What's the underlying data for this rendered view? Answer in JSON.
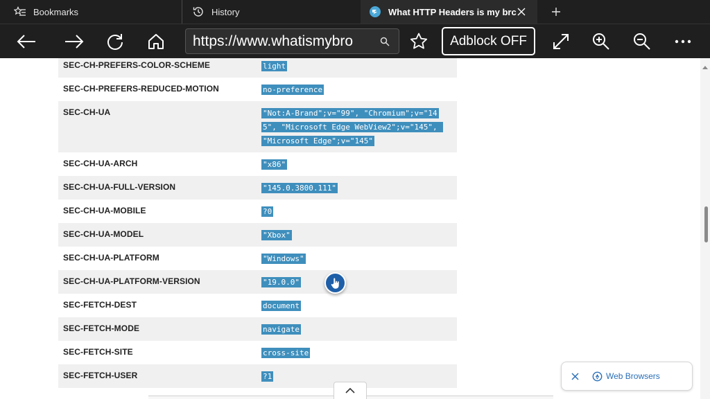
{
  "tabs": {
    "bookmarks": {
      "label": "Bookmarks",
      "icon": "bookmarks-icon"
    },
    "history": {
      "label": "History",
      "icon": "history-icon"
    },
    "active": {
      "label": "What HTTP Headers is my brc",
      "icon": "site-favicon"
    }
  },
  "toolbar": {
    "url": "https://www.whatismybro",
    "adblock_label": "Adblock OFF"
  },
  "headers": [
    {
      "name": "SEC-CH-PREFERS-COLOR-SCHEME",
      "value": "light"
    },
    {
      "name": "SEC-CH-PREFERS-REDUCED-MOTION",
      "value": "no-preference"
    },
    {
      "name": "SEC-CH-UA",
      "value": "\"Not:A-Brand\";v=\"99\", \"Chromium\";v=\"145\", \"Microsoft Edge WebView2\";v=\"145\", \"Microsoft Edge\";v=\"145\""
    },
    {
      "name": "SEC-CH-UA-ARCH",
      "value": "\"x86\""
    },
    {
      "name": "SEC-CH-UA-FULL-VERSION",
      "value": "\"145.0.3800.111\""
    },
    {
      "name": "SEC-CH-UA-MOBILE",
      "value": "?0"
    },
    {
      "name": "SEC-CH-UA-MODEL",
      "value": "\"Xbox\""
    },
    {
      "name": "SEC-CH-UA-PLATFORM",
      "value": "\"Windows\""
    },
    {
      "name": "SEC-CH-UA-PLATFORM-VERSION",
      "value": "\"19.0.0\""
    },
    {
      "name": "SEC-FETCH-DEST",
      "value": "document"
    },
    {
      "name": "SEC-FETCH-MODE",
      "value": "navigate"
    },
    {
      "name": "SEC-FETCH-SITE",
      "value": "cross-site"
    },
    {
      "name": "SEC-FETCH-USER",
      "value": "?1"
    }
  ],
  "chip": {
    "label": "Web Browsers"
  },
  "colors": {
    "chrome_bg": "#1f1f1f",
    "value_highlight": "#3f8fbd",
    "link_blue": "#2a6fb8",
    "cursor_blue": "#1e5fa8"
  }
}
